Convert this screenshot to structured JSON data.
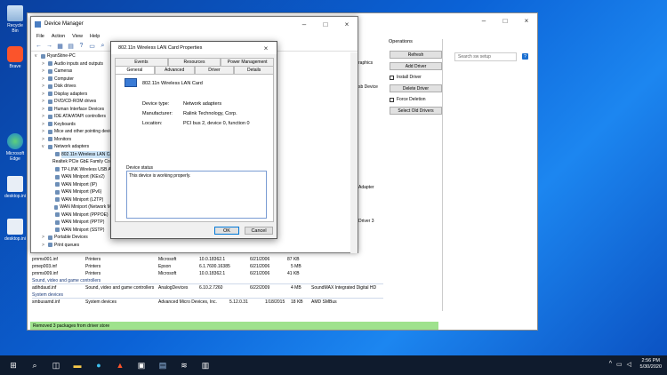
{
  "desktop": {
    "icons": [
      {
        "label": "Recycle Bin"
      },
      {
        "label": "Brave"
      },
      {
        "label": "Microsoft Edge"
      },
      {
        "label": "desktop.ini"
      },
      {
        "label": "desktop.ini"
      }
    ]
  },
  "device_manager": {
    "title": "Device Manager",
    "menu": [
      "File",
      "Action",
      "View",
      "Help"
    ],
    "tree_root": "RyanStine-PC",
    "tree": [
      {
        "label": "Audio inputs and outputs",
        "exp": ">"
      },
      {
        "label": "Cameras",
        "exp": ">"
      },
      {
        "label": "Computer",
        "exp": ">"
      },
      {
        "label": "Disk drives",
        "exp": ">"
      },
      {
        "label": "Display adapters",
        "exp": ">"
      },
      {
        "label": "DVD/CD-ROM drives",
        "exp": ">"
      },
      {
        "label": "Human Interface Devices",
        "exp": ">"
      },
      {
        "label": "IDE ATA/ATAPI controllers",
        "exp": ">"
      },
      {
        "label": "Keyboards",
        "exp": ">"
      },
      {
        "label": "Mice and other pointing devices",
        "exp": ">"
      },
      {
        "label": "Monitors",
        "exp": ">"
      },
      {
        "label": "Network adapters",
        "exp": "v"
      },
      {
        "label": "802.11n Wireless LAN Card",
        "exp": ""
      },
      {
        "label": "Realtek PCIe GbE Family Controller",
        "exp": ""
      },
      {
        "label": "TP-LINK Wireless USB Adapter",
        "exp": ""
      },
      {
        "label": "WAN Miniport (IKEv2)",
        "exp": ""
      },
      {
        "label": "WAN Miniport (IP)",
        "exp": ""
      },
      {
        "label": "WAN Miniport (IPv6)",
        "exp": ""
      },
      {
        "label": "WAN Miniport (L2TP)",
        "exp": ""
      },
      {
        "label": "WAN Miniport (Network Monitor)",
        "exp": ""
      },
      {
        "label": "WAN Miniport (PPPOE)",
        "exp": ""
      },
      {
        "label": "WAN Miniport (PPTP)",
        "exp": ""
      },
      {
        "label": "WAN Miniport (SSTP)",
        "exp": ""
      },
      {
        "label": "Portable Devices",
        "exp": ">"
      },
      {
        "label": "Print queues",
        "exp": ">"
      }
    ]
  },
  "dialog": {
    "title": "802.11n Wireless LAN Card Properties",
    "tabs_row1": [
      "Events",
      "Resources",
      "Power Management"
    ],
    "tabs_row2": [
      "General",
      "Advanced",
      "Driver",
      "Details"
    ],
    "device_name": "802.11n Wireless LAN Card",
    "props": [
      {
        "k": "Device type:",
        "v": "Network adapters"
      },
      {
        "k": "Manufacturer:",
        "v": "Ralink Technology, Corp."
      },
      {
        "k": "Location:",
        "v": "PCI bus 2, device 0, function 0"
      }
    ],
    "status_label": "Device status",
    "status_text": "This device is working properly.",
    "ok": "OK",
    "cancel": "Cancel"
  },
  "operations": {
    "title": "Operations",
    "refresh": "Refresh",
    "add_driver": "Add Driver",
    "install_driver": "Install Driver",
    "delete_driver": "Delete Driver",
    "force_deletion": "Force Deletion",
    "select_old": "Select Old Drivers",
    "search_placeholder": "Search sw setup"
  },
  "behind_text": {
    "graphics": "raphics",
    "usb": "sb Device",
    "adapter": "Adapter",
    "driver3": "Driver 3"
  },
  "table": {
    "rows": [
      {
        "inf": "prnms001.inf",
        "cls": "Printers",
        "prov": "Microsoft",
        "ver": "10.0.18362.1",
        "date": "6/21/2006",
        "size": "87 KB",
        "name": ""
      },
      {
        "inf": "prnep003.inf",
        "cls": "Printers",
        "prov": "Epson",
        "ver": "6.1.7600.16385",
        "date": "6/21/2006",
        "size": "5 MB",
        "name": ""
      },
      {
        "inf": "prnms009.inf",
        "cls": "Printers",
        "prov": "Microsoft",
        "ver": "10.0.18362.1",
        "date": "6/21/2006",
        "size": "41 KB",
        "name": ""
      }
    ],
    "group_sound": "Sound, video and game controllers",
    "sound_row": {
      "inf": "adihdaud.inf",
      "cls": "Sound, video and game controllers",
      "prov": "AnalogDevices",
      "ver": "6.10.2.7260",
      "date": "6/22/2009",
      "size": "4 MB",
      "name": "SoundMAX Integrated Digital HD"
    },
    "group_system": "System devices",
    "system_row": {
      "inf": "smbusamd.inf",
      "cls": "System devices",
      "prov": "Advanced Micro Devices, Inc.",
      "ver": "5.12.0.31",
      "date": "1/18/2015",
      "size": "18 KB",
      "name": "AMD SMBus"
    }
  },
  "statusbar": "Removed 3 packages from driver store",
  "taskbar": {
    "time": "2:56 PM",
    "date": "5/30/2020"
  }
}
